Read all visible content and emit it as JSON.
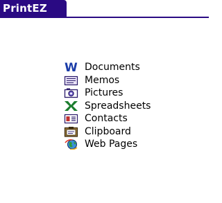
{
  "app": {
    "title": "PrintEZ"
  },
  "menu": {
    "items": [
      {
        "label": "Documents",
        "icon": "word-document-icon"
      },
      {
        "label": "Memos",
        "icon": "memo-icon"
      },
      {
        "label": "Pictures",
        "icon": "camera-icon"
      },
      {
        "label": "Spreadsheets",
        "icon": "excel-spreadsheet-icon"
      },
      {
        "label": "Contacts",
        "icon": "contact-card-icon"
      },
      {
        "label": "Clipboard",
        "icon": "clipboard-icon"
      },
      {
        "label": "Web Pages",
        "icon": "web-globe-icon"
      }
    ]
  },
  "colors": {
    "titlebar": "#2a0a83",
    "word_blue": "#1a3ca8",
    "excel_green": "#1b7d2e"
  }
}
